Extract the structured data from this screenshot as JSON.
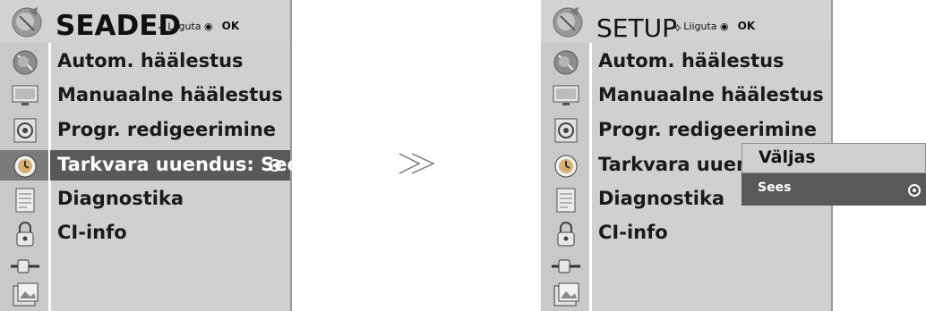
{
  "left_menu": {
    "title": "SEADED",
    "hint_move": "Liiguta",
    "hint_ok": "OK",
    "items": [
      {
        "label": "Autom. häälestus",
        "icon": "satellite-dish-icon"
      },
      {
        "label": "Manuaalne häälestus",
        "icon": "tv-monitor-icon"
      },
      {
        "label": "Progr. redigeerimine",
        "icon": "speaker-icon"
      },
      {
        "label": "Tarkvara uuendus: Sees",
        "icon": "clock-icon"
      },
      {
        "label": "Diagnostika",
        "icon": "document-icon"
      },
      {
        "label": "CI-info",
        "icon": "lock-icon"
      }
    ]
  },
  "right_menu": {
    "title": "SETUP",
    "hint_move": "Liiguta",
    "hint_ok": "OK",
    "items": [
      {
        "label": "Autom. häälestus",
        "icon": "satellite-dish-icon"
      },
      {
        "label": "Manuaalne häälestus",
        "icon": "tv-monitor-icon"
      },
      {
        "label": "Progr. redigeerimine",
        "icon": "speaker-icon"
      },
      {
        "label": "Tarkvara uuendus:",
        "icon": "clock-icon"
      },
      {
        "label": "Diagnostika",
        "icon": "document-icon"
      },
      {
        "label": "CI-info",
        "icon": "lock-icon"
      }
    ],
    "extra_icons": [
      "plug-icon",
      "photo-icon"
    ]
  },
  "popup": {
    "options": [
      "Väljas",
      "Sees"
    ],
    "selected": "Sees"
  },
  "transition_arrow": "≫",
  "colors": {
    "menu_bg": "#d0d0d0",
    "header_bg": "#d2d2d2",
    "selected_bg": "#595959",
    "selected_text": "#ffffff"
  }
}
